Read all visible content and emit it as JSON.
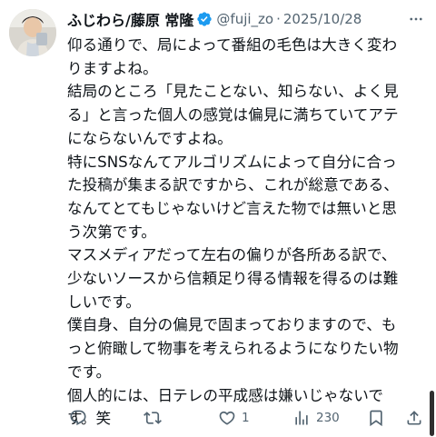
{
  "tweet": {
    "display_name": "ふじわら/藤原 常隆",
    "handle": "@fuji_zo",
    "separator": "·",
    "date": "2025/10/28",
    "lines": [
      "仰る通りで、局によって番組の毛色は大きく変わ",
      "りますよね。",
      "結局のところ「見たことない、知らない、よく見",
      "る」と言った個人の感覚は偏見に満ちていてアテ",
      "にならないんですよね。",
      "特にSNSなんてアルゴリズムによって自分に合っ",
      "た投稿が集まる訳ですから、これが総意である、",
      "なんてとてもじゃないけど言えた物では無いと思",
      "う次第です。",
      "マスメディアだって左右の偏りが各所ある訳で、",
      "少ないソースから信頼足り得る情報を得るのは難",
      "しいです。",
      "僕自身、自分の偏見で固まっておりますので、も",
      "っと俯瞰して物事を考えられるようになりたい物",
      "です。",
      "個人的には、日テレの平成感は嫌いじゃないで",
      "す。笑"
    ]
  },
  "actions": {
    "replies": "",
    "reposts": "",
    "likes": "1",
    "views": "230"
  },
  "icons": {
    "verified": "verified-badge-icon",
    "more": "more-options-icon",
    "reply": "reply-icon",
    "repost": "repost-icon",
    "like": "heart-icon",
    "views": "views-chart-icon",
    "bookmark": "bookmark-icon",
    "share": "share-icon"
  },
  "colors": {
    "verified": "#1d9bf0",
    "text": "#0f1419",
    "muted": "#536471"
  }
}
